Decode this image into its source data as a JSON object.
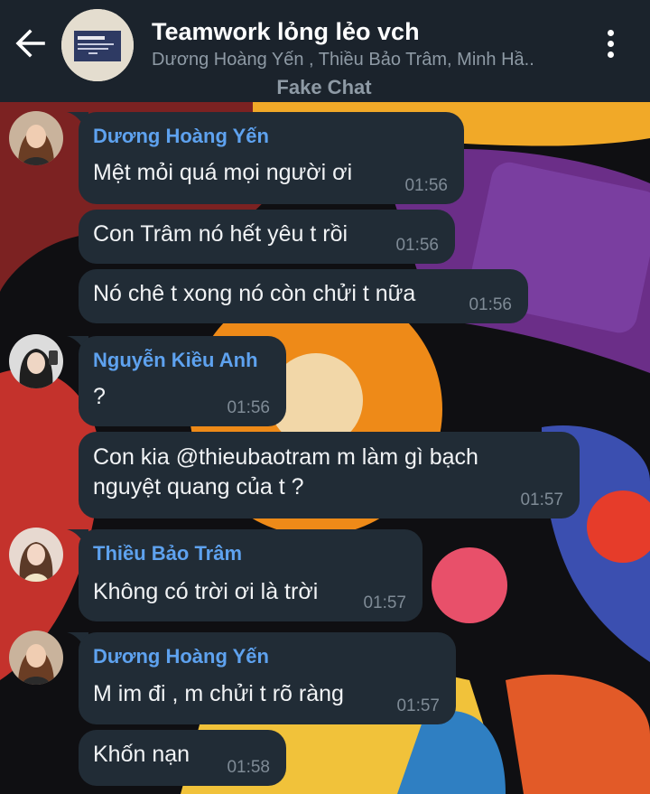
{
  "header": {
    "title": "Teamwork lỏng lẻo vch",
    "members": "Dương Hoàng Yến , Thiều Bảo Trâm, Minh Hầ..",
    "subtitle": "Fake Chat",
    "back_icon": "arrow-left-icon",
    "menu_icon": "more-vertical-icon"
  },
  "colors": {
    "header_bg": "#1b232c",
    "bubble_bg": "#212c36",
    "sender_name": "#5ea2ef",
    "timestamp": "#7f8b96"
  },
  "messages": [
    {
      "sender": "Dương Hoàng Yến",
      "text": "Mệt mỏi quá mọi người ơi",
      "time": "01:56"
    },
    {
      "text": "Con Trâm nó hết yêu t rồi",
      "time": "01:56"
    },
    {
      "text": "Nó chê t xong nó còn chửi t nữa",
      "time": "01:56"
    },
    {
      "sender": "Nguyễn Kiều Anh",
      "text": "?",
      "time": "01:56"
    },
    {
      "text": "Con kia @thieubaotram m làm gì bạch nguyệt quang của t ?",
      "time": "01:57"
    },
    {
      "sender": "Thiều Bảo Trâm",
      "text": "Không có trời ơi là trời",
      "time": "01:57"
    },
    {
      "sender": "Dương Hoàng Yến",
      "text": "M im đi , m chửi t rõ ràng",
      "time": "01:57"
    },
    {
      "text": "Khốn nạn",
      "time": "01:58"
    }
  ]
}
